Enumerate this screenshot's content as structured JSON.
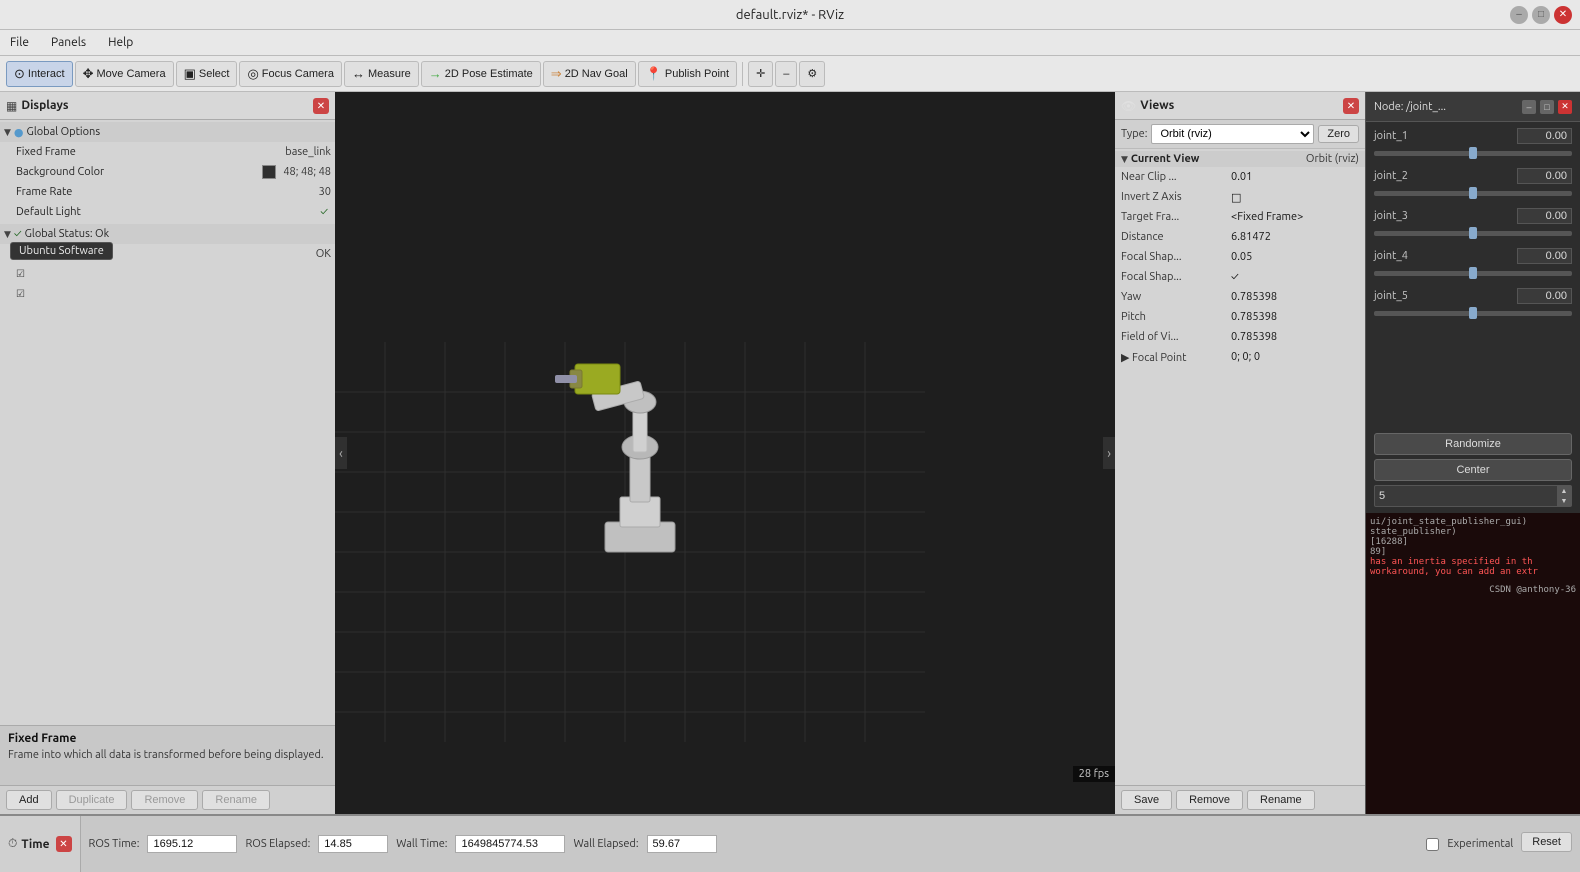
{
  "titlebar": {
    "title": "default.rviz* - RViz",
    "min_label": "–",
    "max_label": "□",
    "close_label": "✕"
  },
  "menubar": {
    "items": [
      "File",
      "Panels",
      "Help"
    ]
  },
  "toolbar": {
    "buttons": [
      {
        "label": "Interact",
        "icon": "⊙",
        "active": true
      },
      {
        "label": "Move Camera",
        "icon": "✥"
      },
      {
        "label": "Select",
        "icon": "▣"
      },
      {
        "label": "Focus Camera",
        "icon": "◎"
      },
      {
        "label": "Measure",
        "icon": "↔"
      },
      {
        "label": "2D Pose Estimate",
        "icon": "→"
      },
      {
        "label": "2D Nav Goal",
        "icon": "⇒"
      },
      {
        "label": "Publish Point",
        "icon": "📍"
      }
    ],
    "extra_icons": [
      "➕",
      "➖",
      "⚙"
    ]
  },
  "displays_panel": {
    "title": "Displays",
    "tree": {
      "global_options": {
        "label": "Global Options",
        "fixed_frame": {
          "label": "Fixed Frame",
          "value": "base_link"
        },
        "background_color": {
          "label": "Background Color",
          "value": "48; 48; 48",
          "color": "#303030"
        },
        "frame_rate": {
          "label": "Frame Rate",
          "value": "30"
        },
        "default_light": {
          "label": "Default Light",
          "checked": true
        }
      },
      "global_status": {
        "label": "Global Status: Ok",
        "fixed_frame": {
          "label": "Fixed Frame",
          "value": "OK"
        }
      },
      "items": [
        {
          "label": "",
          "checked": true
        },
        {
          "label": "",
          "checked": true
        }
      ]
    },
    "info": {
      "title": "Fixed Frame",
      "description": "Frame into which all data is transformed before being displayed."
    },
    "buttons": {
      "add": "Add",
      "duplicate": "Duplicate",
      "remove": "Remove",
      "rename": "Rename"
    }
  },
  "views_panel": {
    "title": "Views",
    "type_label": "Type:",
    "type_value": "Orbit (rviz)",
    "zero_btn": "Zero",
    "current_view": {
      "label": "Current View",
      "orbit_label": "Orbit (rviz)",
      "rows": [
        {
          "label": "Near Clip ...",
          "value": "0.01"
        },
        {
          "label": "Invert Z Axis",
          "value": "□"
        },
        {
          "label": "Target Fra...",
          "value": "<Fixed Frame>"
        },
        {
          "label": "Distance",
          "value": "6.81472"
        },
        {
          "label": "Focal Shap...",
          "value": "0.05"
        },
        {
          "label": "Focal Shap...",
          "value": "✓"
        },
        {
          "label": "Yaw",
          "value": "0.785398"
        },
        {
          "label": "Pitch",
          "value": "0.785398"
        },
        {
          "label": "Field of Vi...",
          "value": "0.785398"
        },
        {
          "label": "▶ Focal Point",
          "value": "0; 0; 0"
        }
      ]
    },
    "buttons": {
      "save": "Save",
      "remove": "Remove",
      "rename": "Rename"
    }
  },
  "joint_panel": {
    "title": "Node: /joint_...",
    "joints": [
      {
        "name": "joint_1",
        "value": "0.00",
        "fill_pct": 50
      },
      {
        "name": "joint_2",
        "value": "0.00",
        "fill_pct": 50
      },
      {
        "name": "joint_3",
        "value": "0.00",
        "fill_pct": 50
      },
      {
        "name": "joint_4",
        "value": "0.00",
        "fill_pct": 50
      },
      {
        "name": "joint_5",
        "value": "0.00",
        "fill_pct": 50
      }
    ],
    "buttons": {
      "randomize": "Randomize",
      "center": "Center"
    },
    "spinbox_value": "5"
  },
  "time_bar": {
    "title": "Time",
    "ros_time_label": "ROS Time:",
    "ros_time_value": "1695.12",
    "ros_elapsed_label": "ROS Elapsed:",
    "ros_elapsed_value": "14.85",
    "wall_time_label": "Wall Time:",
    "wall_time_value": "1649845774.53",
    "wall_elapsed_label": "Wall Elapsed:",
    "wall_elapsed_value": "59.67",
    "experimental_label": "Experimental",
    "reset_btn": "Reset"
  },
  "terminal": {
    "lines": [
      {
        "text": "ui/joint_state_publisher_gui)",
        "class": "normal"
      },
      {
        "text": "state_publisher)",
        "class": "normal"
      },
      {
        "text": "",
        "class": "normal"
      },
      {
        "text": "[16288]",
        "class": "normal"
      },
      {
        "text": "89]",
        "class": "normal"
      },
      {
        "text": "",
        "class": "normal"
      },
      {
        "text": "has an inertia specified in th",
        "class": "red"
      },
      {
        "text": "workaround, you can add an extr",
        "class": "red"
      }
    ]
  },
  "viewport": {
    "fps": "28 fps"
  },
  "tooltip": {
    "text": "Ubuntu Software"
  }
}
